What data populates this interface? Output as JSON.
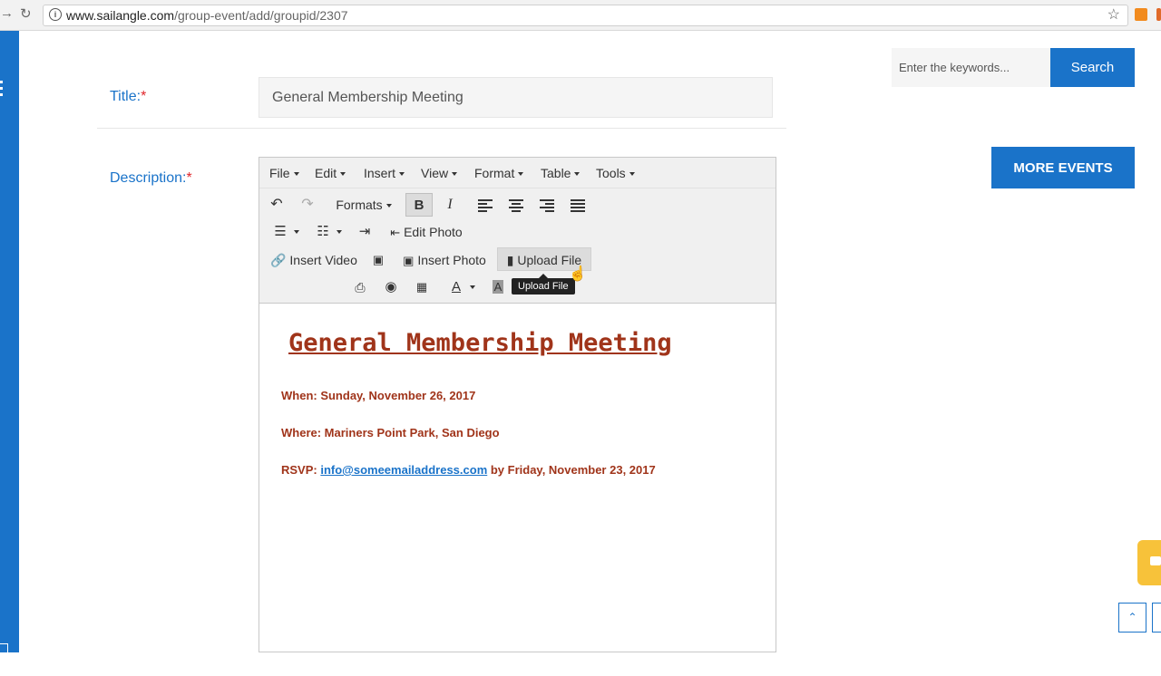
{
  "browser": {
    "url_domain": "www.sailangle.com",
    "url_path": "/group-event/add/groupid/2307"
  },
  "form": {
    "title_label": "Title:",
    "title_value": "General Membership Meeting",
    "description_label": "Description:",
    "required_mark": "*"
  },
  "search": {
    "placeholder": "Enter the keywords...",
    "button_label": "Search"
  },
  "more_events_label": "MORE EVENTS",
  "editor": {
    "menus": [
      "File",
      "Edit",
      "Insert",
      "View",
      "Format",
      "Table",
      "Tools"
    ],
    "formats_label": "Formats",
    "bold_label": "B",
    "italic_label": "I",
    "edit_photo_label": "Edit Photo",
    "insert_video_label": "Insert Video",
    "insert_photo_label": "Insert Photo",
    "upload_file_label": "Upload File",
    "tooltip": "Upload File",
    "text_color_label": "A",
    "bg_color_label": "A"
  },
  "content": {
    "heading": "General Membership Meeting",
    "when": "When: Sunday, November 26, 2017",
    "where": "Where: Mariners Point Park, San Diego",
    "rsvp_prefix": "RSVP: ",
    "rsvp_email": "info@someemailaddress.com",
    "rsvp_suffix": " by Friday, November 23, 2017"
  },
  "colors": {
    "accent": "#1a73c9",
    "content_text": "#a0341a",
    "required": "#e0262b"
  }
}
